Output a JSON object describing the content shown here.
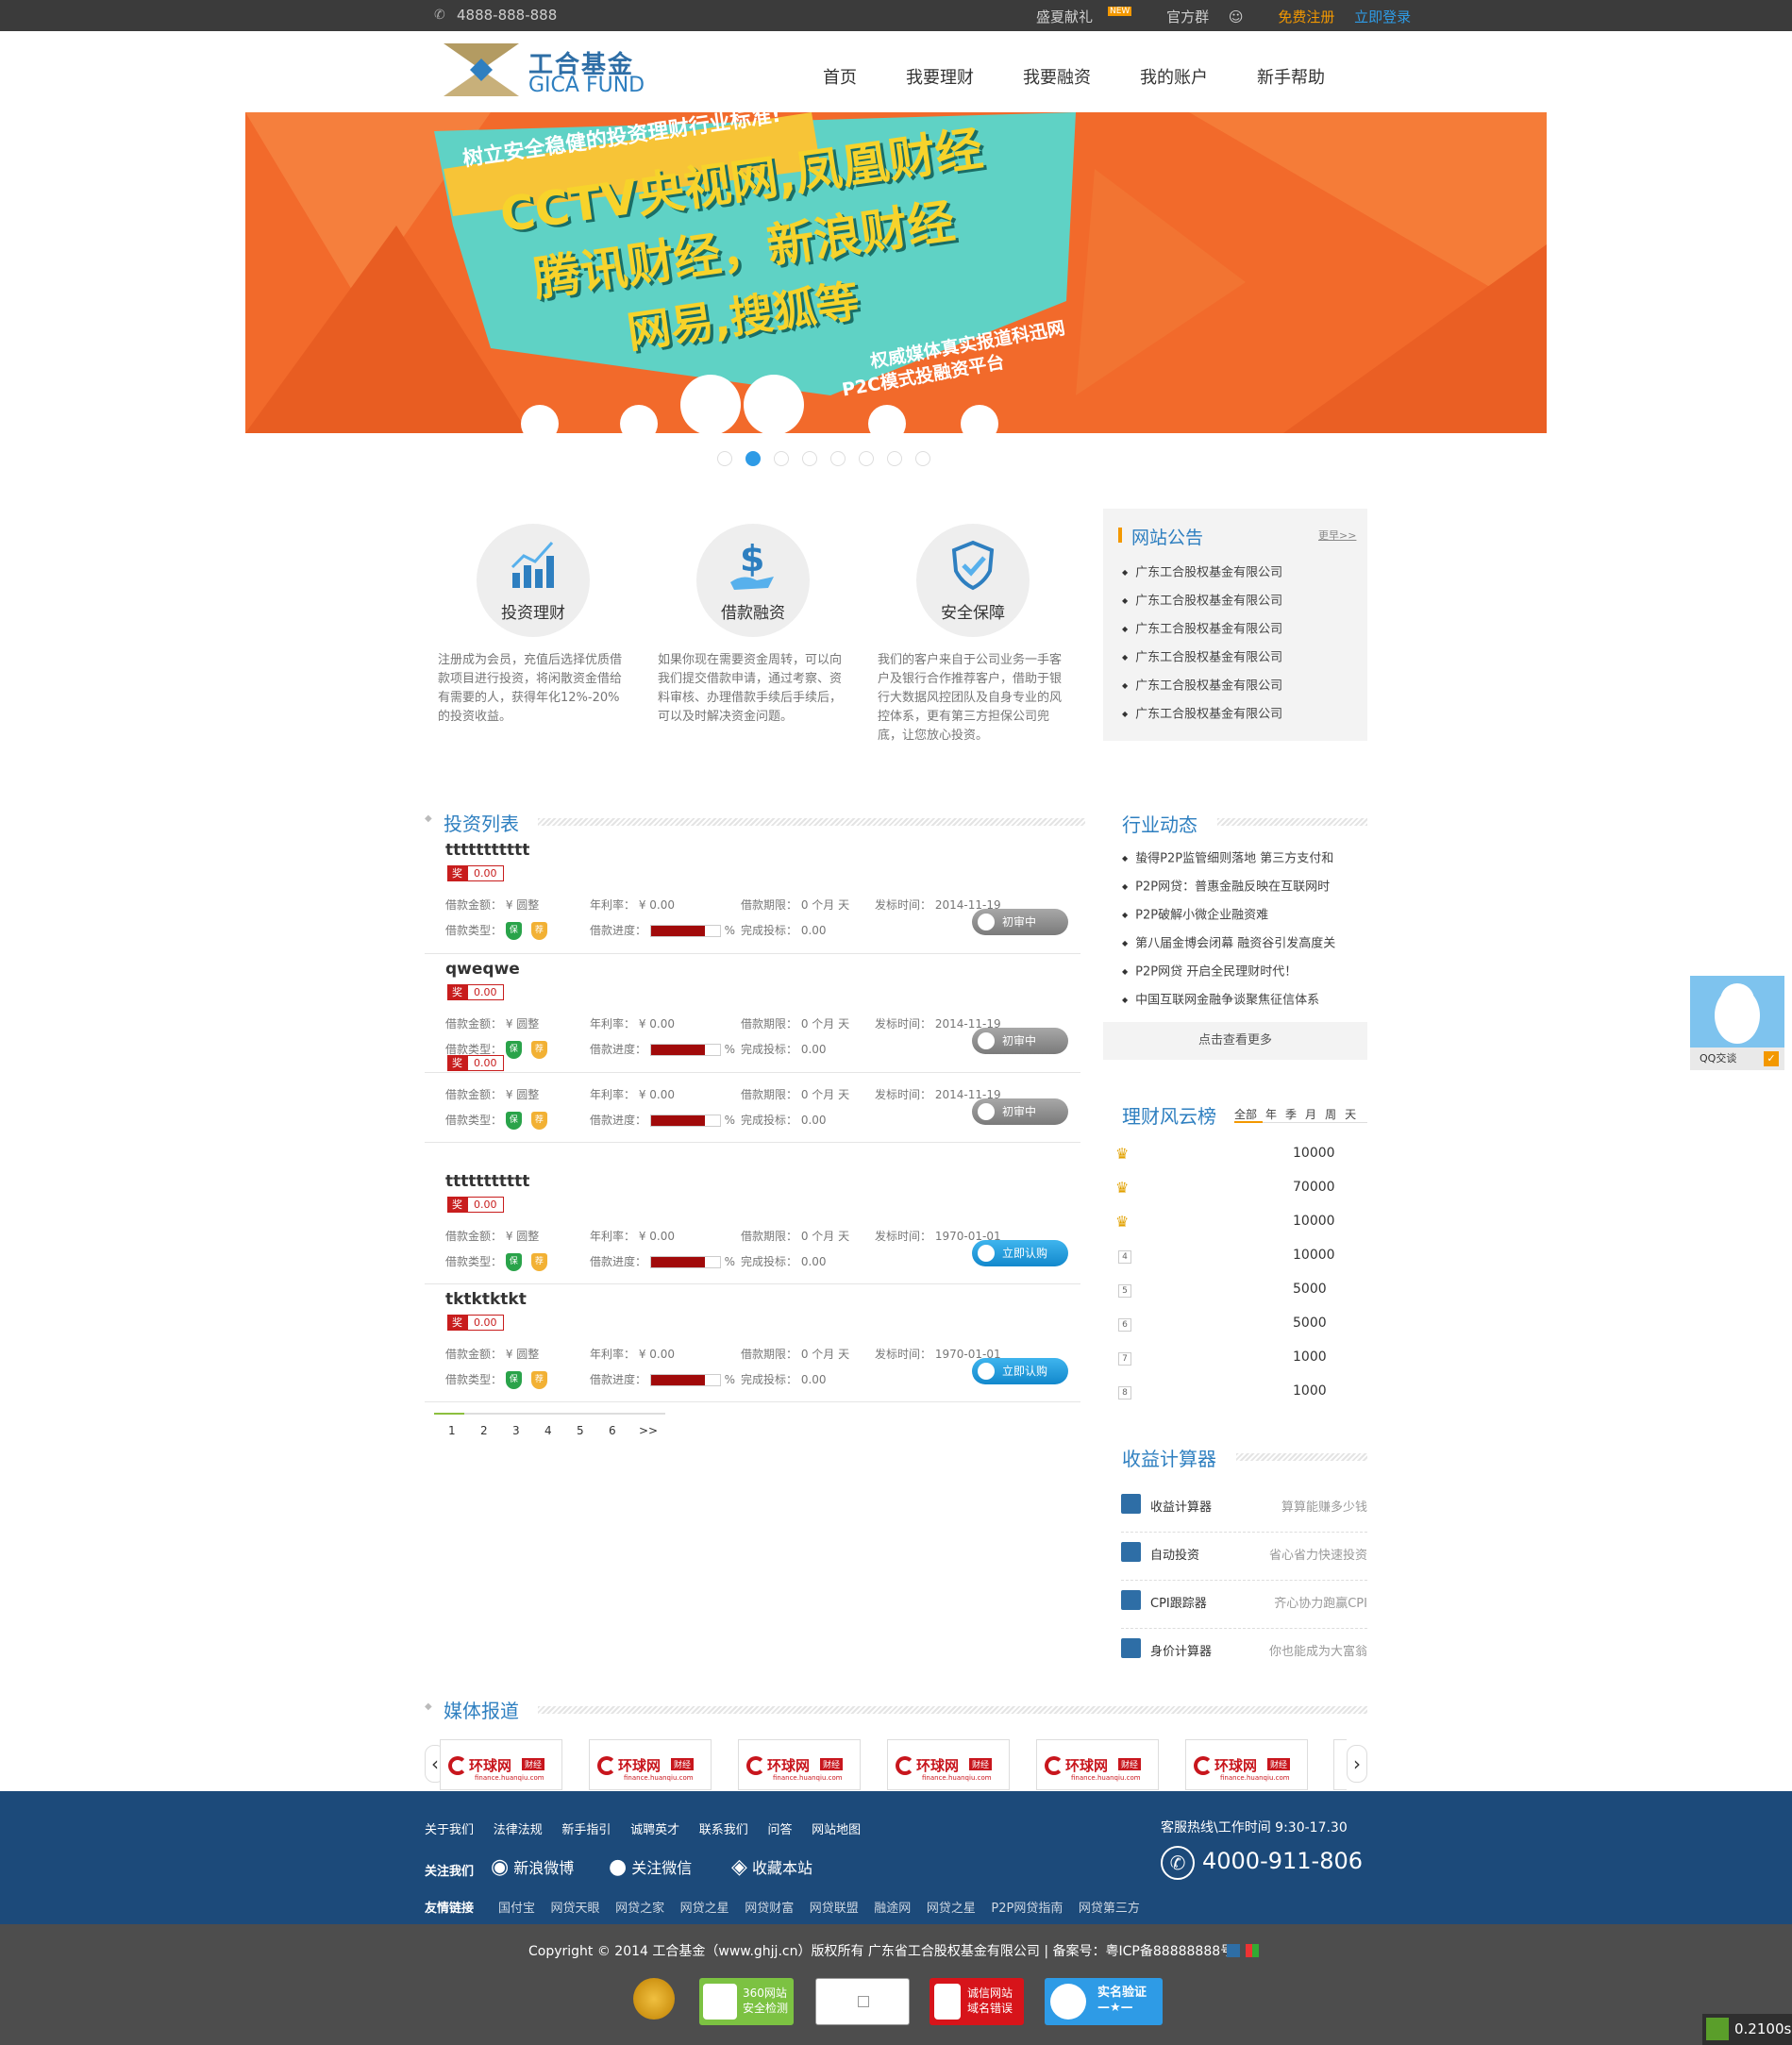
{
  "topbar": {
    "phone": "4888-888-888",
    "gift": "盛夏献礼",
    "gift_badge": "NEW",
    "group": "官方群",
    "register": "免费注册",
    "login": "立即登录"
  },
  "logo": {
    "cn": "工合基金",
    "en": "GICA FUND"
  },
  "nav": [
    "首页",
    "我要理财",
    "我要融资",
    "我的账户",
    "新手帮助"
  ],
  "banner": {
    "ribbon": "树立安全稳健的投资理财行业标准!",
    "line1": "CCTV央视网,凤凰财经",
    "line2": "腾讯财经，新浪财经",
    "line3": "网易,搜狐等",
    "sub1": "权威媒体真实报道科迅网",
    "sub2": "P2C模式投融资平台",
    "slide_count": 8,
    "active_slide": 2
  },
  "features": [
    {
      "label": "投资理财",
      "icon": "chart-icon",
      "desc": "注册成为会员，充值后选择优质借款项目进行投资，将闲散资金借给有需要的人，获得年化12%-20%的投资收益。"
    },
    {
      "label": "借款融资",
      "icon": "dollar-hand-icon",
      "desc": "如果你现在需要资金周转，可以向我们提交借款申请，通过考察、资料审核、办理借款手续后手续后，可以及时解决资金问题。"
    },
    {
      "label": "安全保障",
      "icon": "shield-check-icon",
      "desc": "我们的客户来自于公司业务一手客户及银行合作推荐客户，借助于银行大数据风控团队及自身专业的风控体系，更有第三方担保公司兜底，让您放心投资。"
    }
  ],
  "notice": {
    "title": "网站公告",
    "more": "更早>>",
    "items": [
      "广东工合股权基金有限公司",
      "广东工合股权基金有限公司",
      "广东工合股权基金有限公司",
      "广东工合股权基金有限公司",
      "广东工合股权基金有限公司",
      "广东工合股权基金有限公司"
    ]
  },
  "invest": {
    "title": "投资列表",
    "labels": {
      "amount": "借款金额：",
      "amount_unit": "¥ 圆整",
      "rate": "年利率：",
      "rate_val": "¥ 0.00",
      "term": "借款期限：",
      "term_val": "0 个月 天",
      "date": "发标时间：",
      "type": "借款类型：",
      "progress": "借款进度：",
      "pct": "%",
      "done": "完成投标：",
      "done_val": "0.00",
      "jiang": "奖",
      "shield_a": "保",
      "shield_b": "荐"
    },
    "items": [
      {
        "name": "ttttttttttt",
        "award": "0.00",
        "date": "2014-11-19",
        "button": "初审中",
        "state": "gray",
        "progress": 78
      },
      {
        "name": "qweqwe",
        "award": "0.00",
        "date": "2014-11-19",
        "button": "初审中",
        "state": "gray",
        "progress": 78
      },
      {
        "name": "",
        "award": "0.00",
        "date": "2014-11-19",
        "button": "初审中",
        "state": "gray",
        "progress": 78
      },
      {
        "name": "ttttttttttt",
        "award": "0.00",
        "date": "1970-01-01",
        "button": "立即认购",
        "state": "blue",
        "progress": 78
      },
      {
        "name": "tktktktkt",
        "award": "0.00",
        "date": "1970-01-01",
        "button": "立即认购",
        "state": "blue",
        "progress": 78
      }
    ],
    "pager": [
      "1",
      "2",
      "3",
      "4",
      "5",
      "6",
      ">>"
    ]
  },
  "industry": {
    "title": "行业动态",
    "items": [
      "蛰得P2P监管细则落地 第三方支付和",
      "P2P网贷：普惠金融反映在互联网时",
      "P2P破解小微企业融资难",
      "第八届金博会闭幕 融资谷引发高度关",
      "P2P网贷 开启全民理财时代！",
      "中国互联网金融争谈聚焦征信体系"
    ],
    "more": "点击查看更多"
  },
  "ranking": {
    "title": "理财风云榜",
    "tabs": [
      "全部",
      "年",
      "季",
      "月",
      "周",
      "天"
    ],
    "rows": [
      {
        "rank": "1",
        "value": "10000"
      },
      {
        "rank": "2",
        "value": "70000"
      },
      {
        "rank": "3",
        "value": "10000"
      },
      {
        "rank": "4",
        "value": "10000"
      },
      {
        "rank": "5",
        "value": "5000"
      },
      {
        "rank": "6",
        "value": "5000"
      },
      {
        "rank": "7",
        "value": "1000"
      },
      {
        "rank": "8",
        "value": "1000"
      }
    ]
  },
  "calculator": {
    "title": "收益计算器",
    "items": [
      {
        "name": "收益计算器",
        "desc": "算算能赚多少钱"
      },
      {
        "name": "自动投资",
        "desc": "省心省力快速投资"
      },
      {
        "name": "CPI跟踪器",
        "desc": "齐心协力跑赢CPI"
      },
      {
        "name": "身价计算器",
        "desc": "你也能成为大富翁"
      }
    ]
  },
  "media": {
    "title": "媒体报道",
    "logos": [
      {
        "name": "环球网",
        "tag": "财经",
        "url": "finance.huanqiu.com"
      },
      {
        "name": "环球网",
        "tag": "财经",
        "url": "finance.huanqiu.com"
      },
      {
        "name": "环球网",
        "tag": "财经",
        "url": "finance.huanqiu.com"
      },
      {
        "name": "环球网",
        "tag": "财经",
        "url": "finance.huanqiu.com"
      },
      {
        "name": "环球网",
        "tag": "财经",
        "url": "finance.huanqiu.com"
      },
      {
        "name": "环球网",
        "tag": "财经",
        "url": "finance.huanqiu.com"
      }
    ]
  },
  "qq": {
    "label": "QQ交谈"
  },
  "footer": {
    "links": [
      "关于我们",
      "法律法规",
      "新手指引",
      "诚聘英才",
      "联系我们",
      "问答",
      "网站地图"
    ],
    "follow": "关注我们",
    "weibo": "新浪微博",
    "weixin": "关注微信",
    "favorite": "收藏本站",
    "hotline_label": "客服热线\\工作时间 9:30-17.30",
    "hotline": "4000-911-806",
    "friend_label": "友情链接",
    "friends": [
      "国付宝",
      "网贷天眼",
      "网贷之家",
      "网贷之星",
      "网贷财富",
      "网贷联盟",
      "融途网",
      "网贷之星",
      "P2P网贷指南",
      "网贷第三方"
    ],
    "copyright": "Copyright © 2014 工合基金（www.ghjj.cn）版权所有 广东省工合股权基金有限公司 | 备案号：粤ICP备88888888号",
    "badges": [
      {
        "line1": "360网站",
        "line2": "安全检测"
      },
      {
        "line1": "诚信网站",
        "line2": "域名错误"
      },
      {
        "line1": "实名验证",
        "line2": "—★—"
      }
    ]
  },
  "timer": "0.2100s"
}
